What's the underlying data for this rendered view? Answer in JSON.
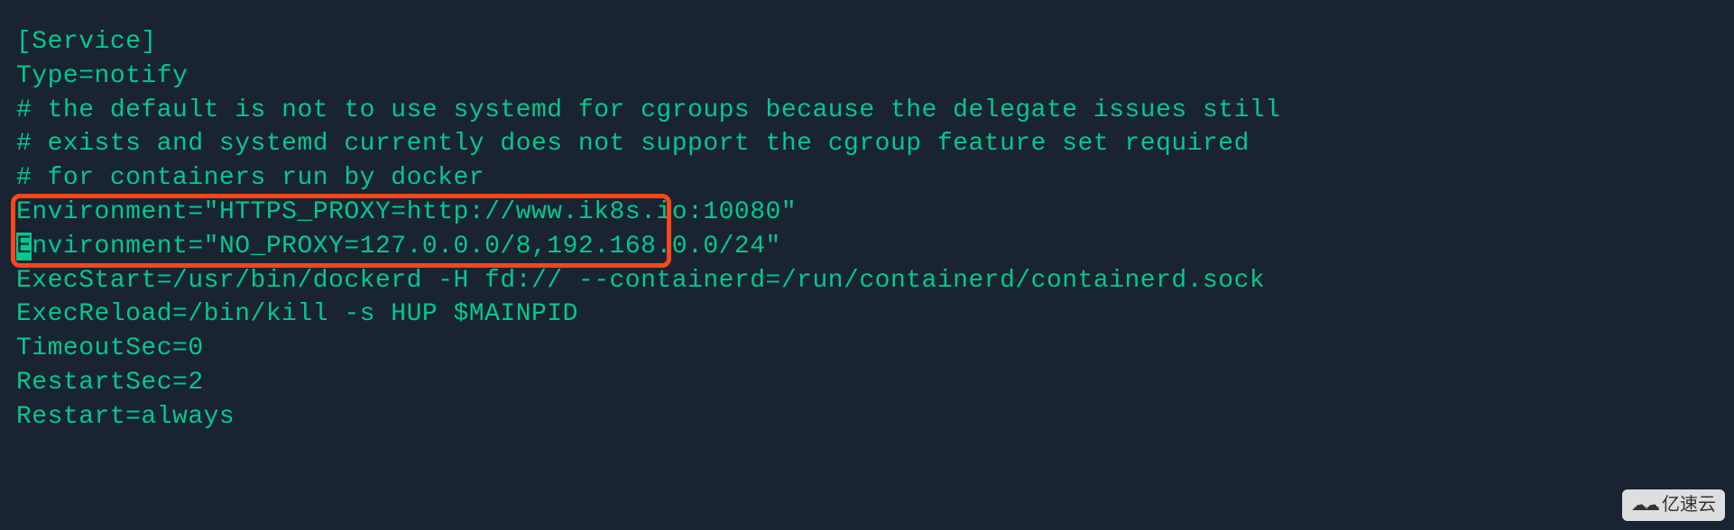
{
  "lines": {
    "0": "[Service]",
    "1": "Type=notify",
    "2": "# the default is not to use systemd for cgroups because the delegate issues still",
    "3": "# exists and systemd currently does not support the cgroup feature set required",
    "4": "# for containers run by docker",
    "5_cursor": "E",
    "5_rest": "nvironment=\"HTTPS_PROXY=http://www.ik8s.io:10080\"",
    "6_cursor": "E",
    "6_rest": "nvironment=\"NO_PROXY=127.0.0.0/8,192.168.0.0/24\"",
    "7": "ExecStart=/usr/bin/dockerd -H fd:// --containerd=/run/containerd/containerd.sock",
    "8": "ExecReload=/bin/kill -s HUP $MAINPID",
    "9": "TimeoutSec=0",
    "10": "RestartSec=2",
    "11": "Restart=always"
  },
  "watermark": {
    "text": "亿速云"
  }
}
